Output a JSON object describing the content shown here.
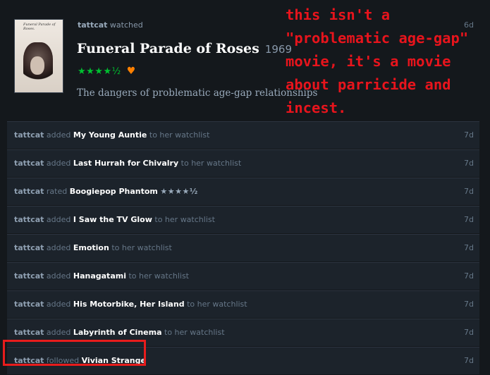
{
  "review": {
    "user": "tattcat",
    "action": "watched",
    "film_title": "Funeral Parade of Roses",
    "year": "1969",
    "stars": "★★★★½",
    "liked": true,
    "text": "The dangers of problematic age-gap relationships",
    "date": "6d",
    "poster_text": "Funeral Parade of Roses."
  },
  "annotation": {
    "text": "this isn't a \"problematic age-gap\" movie, it's a movie about parricide and incest."
  },
  "activity": [
    {
      "user": "tattcat",
      "verb": "added",
      "film": "My Young Auntie",
      "suffix": "to her watchlist",
      "stars": "",
      "date": "7d"
    },
    {
      "user": "tattcat",
      "verb": "added",
      "film": "Last Hurrah for Chivalry",
      "suffix": "to her watchlist",
      "stars": "",
      "date": "7d"
    },
    {
      "user": "tattcat",
      "verb": "rated",
      "film": "Boogiepop Phantom",
      "suffix": "",
      "stars": "★★★★½",
      "date": "7d"
    },
    {
      "user": "tattcat",
      "verb": "added",
      "film": "I Saw the TV Glow",
      "suffix": "to her watchlist",
      "stars": "",
      "date": "7d"
    },
    {
      "user": "tattcat",
      "verb": "added",
      "film": "Emotion",
      "suffix": "to her watchlist",
      "stars": "",
      "date": "7d"
    },
    {
      "user": "tattcat",
      "verb": "added",
      "film": "Hanagatami",
      "suffix": "to her watchlist",
      "stars": "",
      "date": "7d"
    },
    {
      "user": "tattcat",
      "verb": "added",
      "film": "His Motorbike, Her Island",
      "suffix": "to her watchlist",
      "stars": "",
      "date": "7d"
    },
    {
      "user": "tattcat",
      "verb": "added",
      "film": "Labyrinth of Cinema",
      "suffix": "to her watchlist",
      "stars": "",
      "date": "7d"
    },
    {
      "user": "tattcat",
      "verb": "followed",
      "film": "Vivian Strange",
      "suffix": "",
      "stars": "",
      "date": "7d"
    }
  ],
  "colors": {
    "annotation": "#e8141c",
    "rating_green": "#00c030",
    "heart_orange": "#ff8000",
    "highlight": "#e81c1c"
  }
}
